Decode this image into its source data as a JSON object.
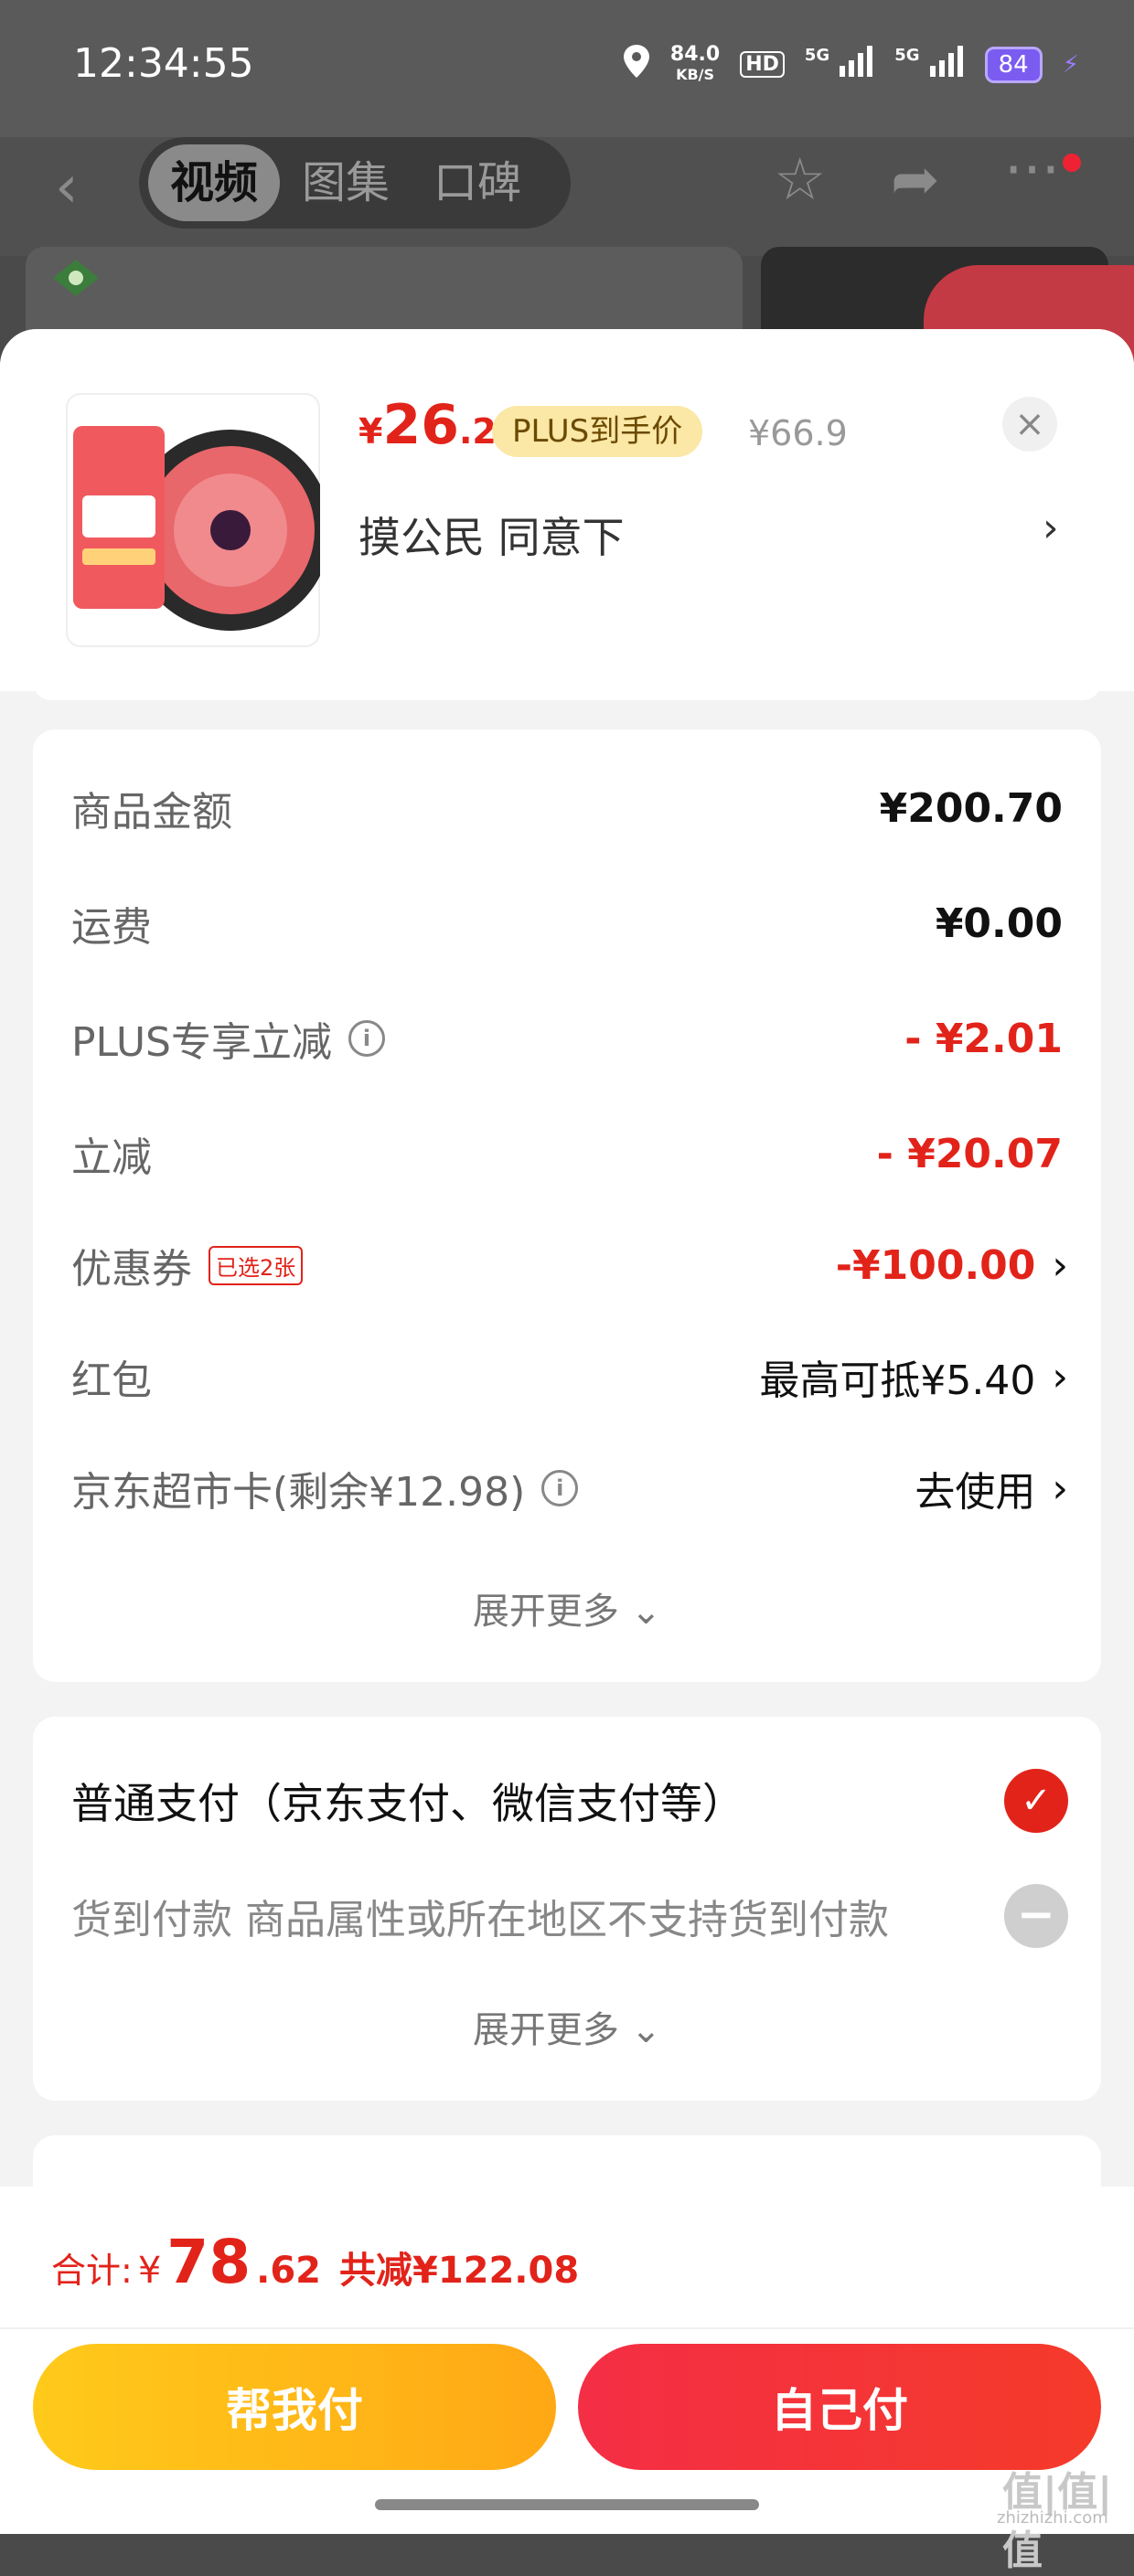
{
  "status_bar": {
    "time": "12:34:55",
    "net_speed_value": "84.0",
    "net_speed_unit": "KB/S",
    "hd_label": "HD",
    "signal1_label": "5G",
    "signal2_label": "5G",
    "battery": "84"
  },
  "nav": {
    "tabs": [
      {
        "label": "视频",
        "active": true
      },
      {
        "label": "图集",
        "active": false
      },
      {
        "label": "口碑",
        "active": false
      }
    ]
  },
  "product": {
    "price_symbol": "¥",
    "price_int": "26",
    "price_dec": ".2",
    "plus_tag": "PLUS到手价",
    "original_price": "¥66.9",
    "address": "摸公民  同意下",
    "close_glyph": "×"
  },
  "summary": {
    "rows": [
      {
        "label": "商品金额",
        "value": "¥200.70"
      },
      {
        "label": "运费",
        "value": "¥0.00"
      },
      {
        "label": "PLUS专享立减",
        "value": "- ¥2.01"
      },
      {
        "label": "立减",
        "value": "- ¥20.07"
      },
      {
        "label": "优惠券",
        "badge": "已选2张",
        "value": "-¥100.00"
      },
      {
        "label": "红包",
        "value": "最高可抵¥5.40"
      },
      {
        "label": "京东超市卡(剩余¥12.98)",
        "value": "去使用"
      }
    ],
    "expand_label": "展开更多"
  },
  "payment": {
    "options": [
      {
        "label": "普通支付（京东支付、微信支付等）",
        "selected": true
      },
      {
        "label": "货到付款 商品属性或所在地区不支持货到付款",
        "selected": false
      }
    ],
    "expand_label": "展开更多"
  },
  "footer": {
    "total_label": "合计:",
    "total_symbol": "¥",
    "total_int": "78",
    "total_dec": ".62",
    "saved": "共减¥122.08",
    "help_pay_label": "帮我付",
    "self_pay_label": "自己付"
  },
  "watermark": {
    "text": "值|值|值",
    "site": "zhizhizhi.com"
  },
  "colors": {
    "accent_red": "#e2231a",
    "plus_tag_bg": "#fbe7a6",
    "help_btn": "#ffb81a",
    "self_btn": "#f33040"
  }
}
